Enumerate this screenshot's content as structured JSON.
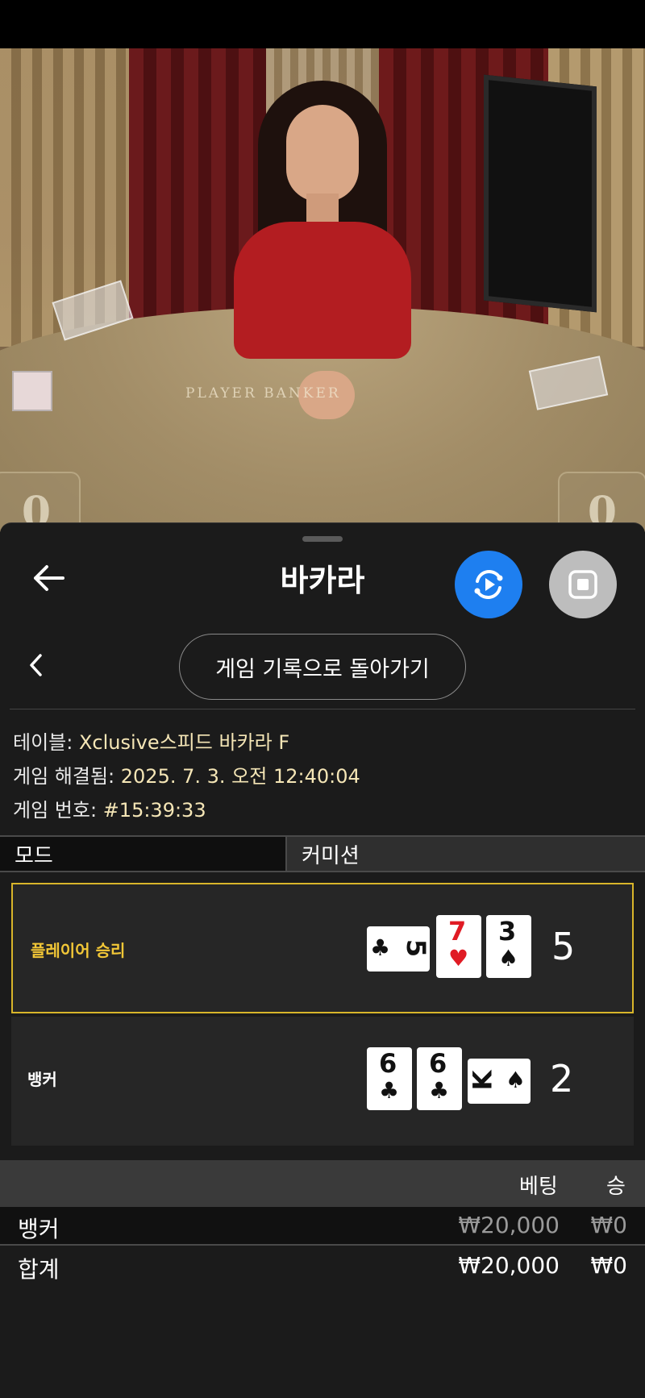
{
  "video": {
    "table_text": "PLAYER  BANKER",
    "player_score": "0",
    "banker_score": "0"
  },
  "header": {
    "title": "바카라"
  },
  "nav": {
    "history_button": "게임 기록으로 돌아가기"
  },
  "info": {
    "table_label": "테이블:",
    "table_value": "Xclusive스피드 바카라 F",
    "resolved_label": "게임 해결됨:",
    "resolved_value": "2025. 7. 3. 오전 12:40:04",
    "number_label": "게임 번호:",
    "number_value": "#15:39:33"
  },
  "tabs": {
    "mode": "모드",
    "commission": "커미션"
  },
  "hands": {
    "player": {
      "label": "플레이어 승리",
      "score": "5",
      "cards": [
        {
          "rank": "5",
          "suit": "♣",
          "color": "#111111",
          "orientation": "horizontal"
        },
        {
          "rank": "7",
          "suit": "♥",
          "color": "#e01b24",
          "orientation": "vertical"
        },
        {
          "rank": "3",
          "suit": "♠",
          "color": "#111111",
          "orientation": "vertical"
        }
      ]
    },
    "banker": {
      "label": "뱅커",
      "score": "2",
      "cards": [
        {
          "rank": "6",
          "suit": "♣",
          "color": "#111111",
          "orientation": "vertical"
        },
        {
          "rank": "6",
          "suit": "♣",
          "color": "#111111",
          "orientation": "vertical"
        },
        {
          "rank": "K",
          "suit": "♠",
          "color": "#111111",
          "orientation": "horizontal"
        }
      ]
    }
  },
  "bets": {
    "columns": {
      "bet": "베팅",
      "win": "승"
    },
    "rows": [
      {
        "name": "뱅커",
        "bet": "₩20,000",
        "win": "₩0"
      }
    ],
    "total": {
      "name": "합계",
      "bet": "₩20,000",
      "win": "₩0"
    }
  },
  "colors": {
    "accent_blue": "#1e7ff0",
    "winner_gold": "#d8b52a",
    "info_value": "#f5e6b6"
  },
  "icons": {
    "back": "arrow-left-icon",
    "replay": "replay-icon",
    "stop": "stop-icon",
    "chevron": "chevron-left-icon"
  }
}
